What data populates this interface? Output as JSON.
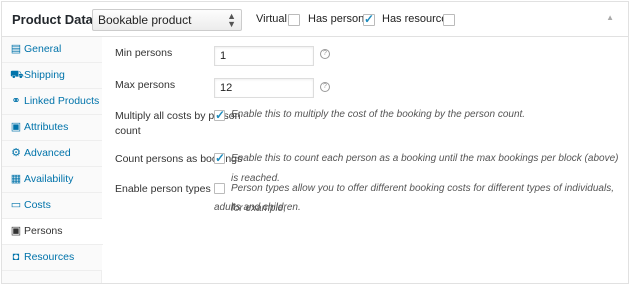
{
  "header": {
    "title": "Product Data —",
    "product_type": "Bookable product",
    "options": [
      {
        "label": "Virtual:",
        "checked": false
      },
      {
        "label": "Has persons:",
        "checked": true
      },
      {
        "label": "Has resources:",
        "checked": false
      }
    ],
    "collapse_icon": "triangle-up-icon"
  },
  "sidebar": {
    "items": [
      {
        "label": "General",
        "icon": "general-icon",
        "active": false
      },
      {
        "label": "Shipping",
        "icon": "truck-icon",
        "active": false
      },
      {
        "label": "Linked Products",
        "icon": "link-icon",
        "active": false
      },
      {
        "label": "Attributes",
        "icon": "list-icon",
        "active": false
      },
      {
        "label": "Advanced",
        "icon": "gear-icon",
        "active": false
      },
      {
        "label": "Availability",
        "icon": "calendar-icon",
        "active": false
      },
      {
        "label": "Costs",
        "icon": "costs-icon",
        "active": false
      },
      {
        "label": "Persons",
        "icon": "person-icon",
        "active": true
      },
      {
        "label": "Resources",
        "icon": "resources-icon",
        "active": false
      }
    ]
  },
  "fields": {
    "min_persons": {
      "label": "Min persons",
      "value": "1"
    },
    "max_persons": {
      "label": "Max persons",
      "value": "12"
    },
    "multiply_costs": {
      "label_line1": "Multiply all costs by person",
      "label_line2": "count",
      "checked": true,
      "description": "Enable this to multiply the cost of the booking by the person count."
    },
    "count_persons": {
      "label": "Count persons as bookings",
      "checked": true,
      "description": "Enable this to count each person as a booking until the max bookings per block (above) is reached."
    },
    "person_types": {
      "label": "Enable person types",
      "checked": false,
      "description_line1": "Person types allow you to offer different booking costs for different types of individuals, for example,",
      "description_line2": "adults and children."
    },
    "help_glyph": "?"
  },
  "colors": {
    "accent": "#0073aa",
    "check": "#1e8cbe"
  }
}
